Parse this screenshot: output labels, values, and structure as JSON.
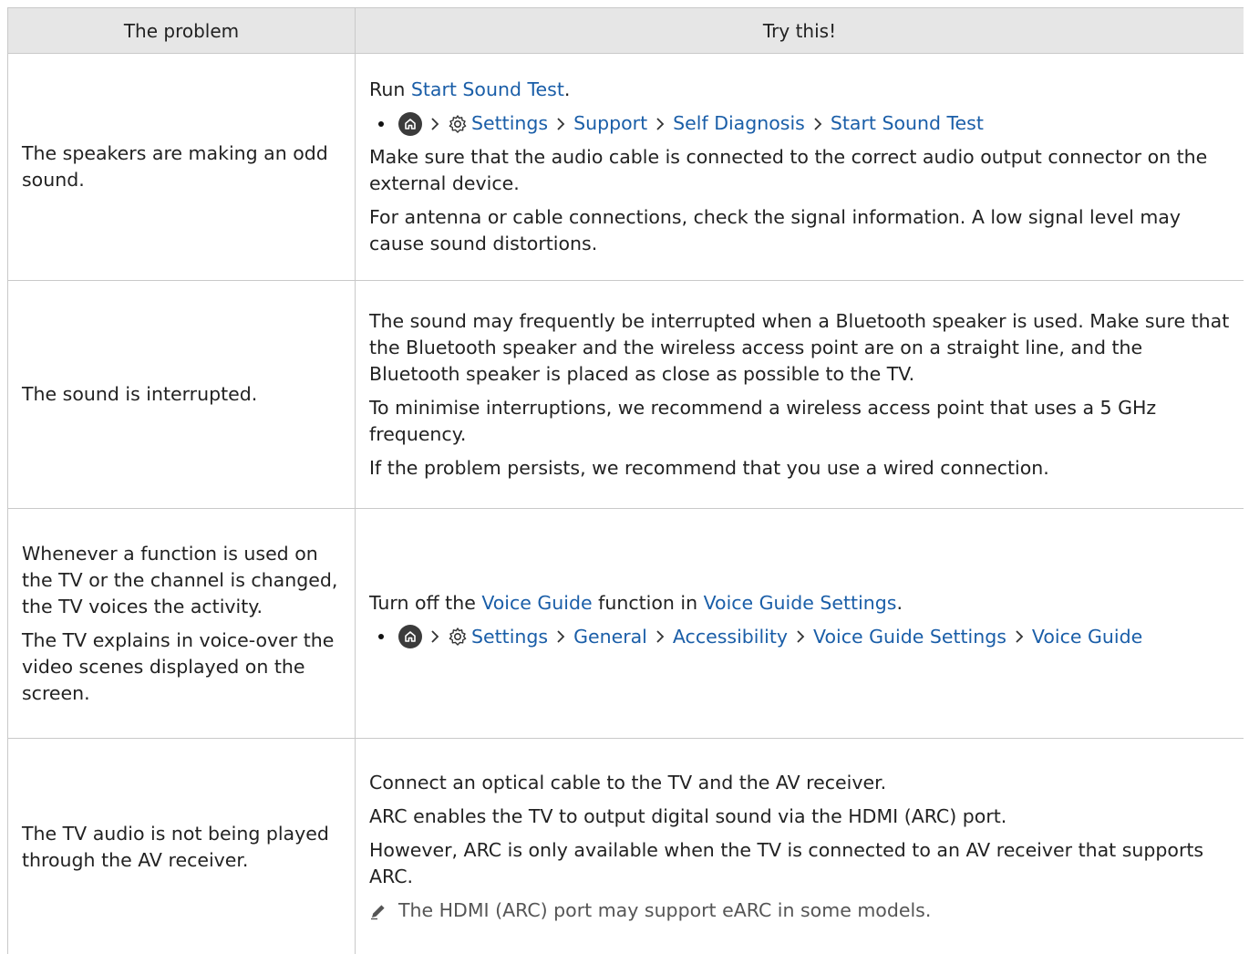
{
  "header": {
    "col1": "The problem",
    "col2": "Try this!"
  },
  "rows": [
    {
      "problem": [
        "The speakers are making an odd sound."
      ],
      "run_prefix": "Run ",
      "run_link": "Start Sound Test",
      "run_suffix": ".",
      "path": [
        "Settings",
        "Support",
        "Self Diagnosis",
        "Start Sound Test"
      ],
      "paras": [
        "Make sure that the audio cable is connected to the correct audio output connector on the external device.",
        "For antenna or cable connections, check the signal information. A low signal level may cause sound distortions."
      ]
    },
    {
      "problem": [
        "The sound is interrupted."
      ],
      "paras": [
        "The sound may frequently be interrupted when a Bluetooth speaker is used. Make sure that the Bluetooth speaker and the wireless access point are on a straight line, and the Bluetooth speaker is placed as close as possible to the TV.",
        "To minimise interruptions, we recommend a wireless access point that uses a 5 GHz frequency.",
        "If the problem persists, we recommend that you use a wired connection."
      ]
    },
    {
      "problem": [
        "Whenever a function is used on the TV or the channel is changed, the TV voices the activity.",
        "The TV explains in voice-over the video scenes displayed on the screen."
      ],
      "intro_prefix": "Turn off the ",
      "intro_link1": "Voice Guide",
      "intro_mid": " function in ",
      "intro_link2": "Voice Guide Settings",
      "intro_suffix": ".",
      "path": [
        "Settings",
        "General",
        "Accessibility",
        "Voice Guide Settings",
        "Voice Guide"
      ]
    },
    {
      "problem": [
        "The TV audio is not being played through the AV receiver."
      ],
      "paras": [
        "Connect an optical cable to the TV and the AV receiver.",
        "ARC enables the TV to output digital sound via the HDMI (ARC) port.",
        "However, ARC is only available when the TV is connected to an AV receiver that supports ARC."
      ],
      "note": "The HDMI (ARC) port may support eARC in some models."
    }
  ],
  "colors": {
    "link": "#1a5ea8",
    "header_bg": "#e6e6e6",
    "border": "#c9c9c9"
  }
}
